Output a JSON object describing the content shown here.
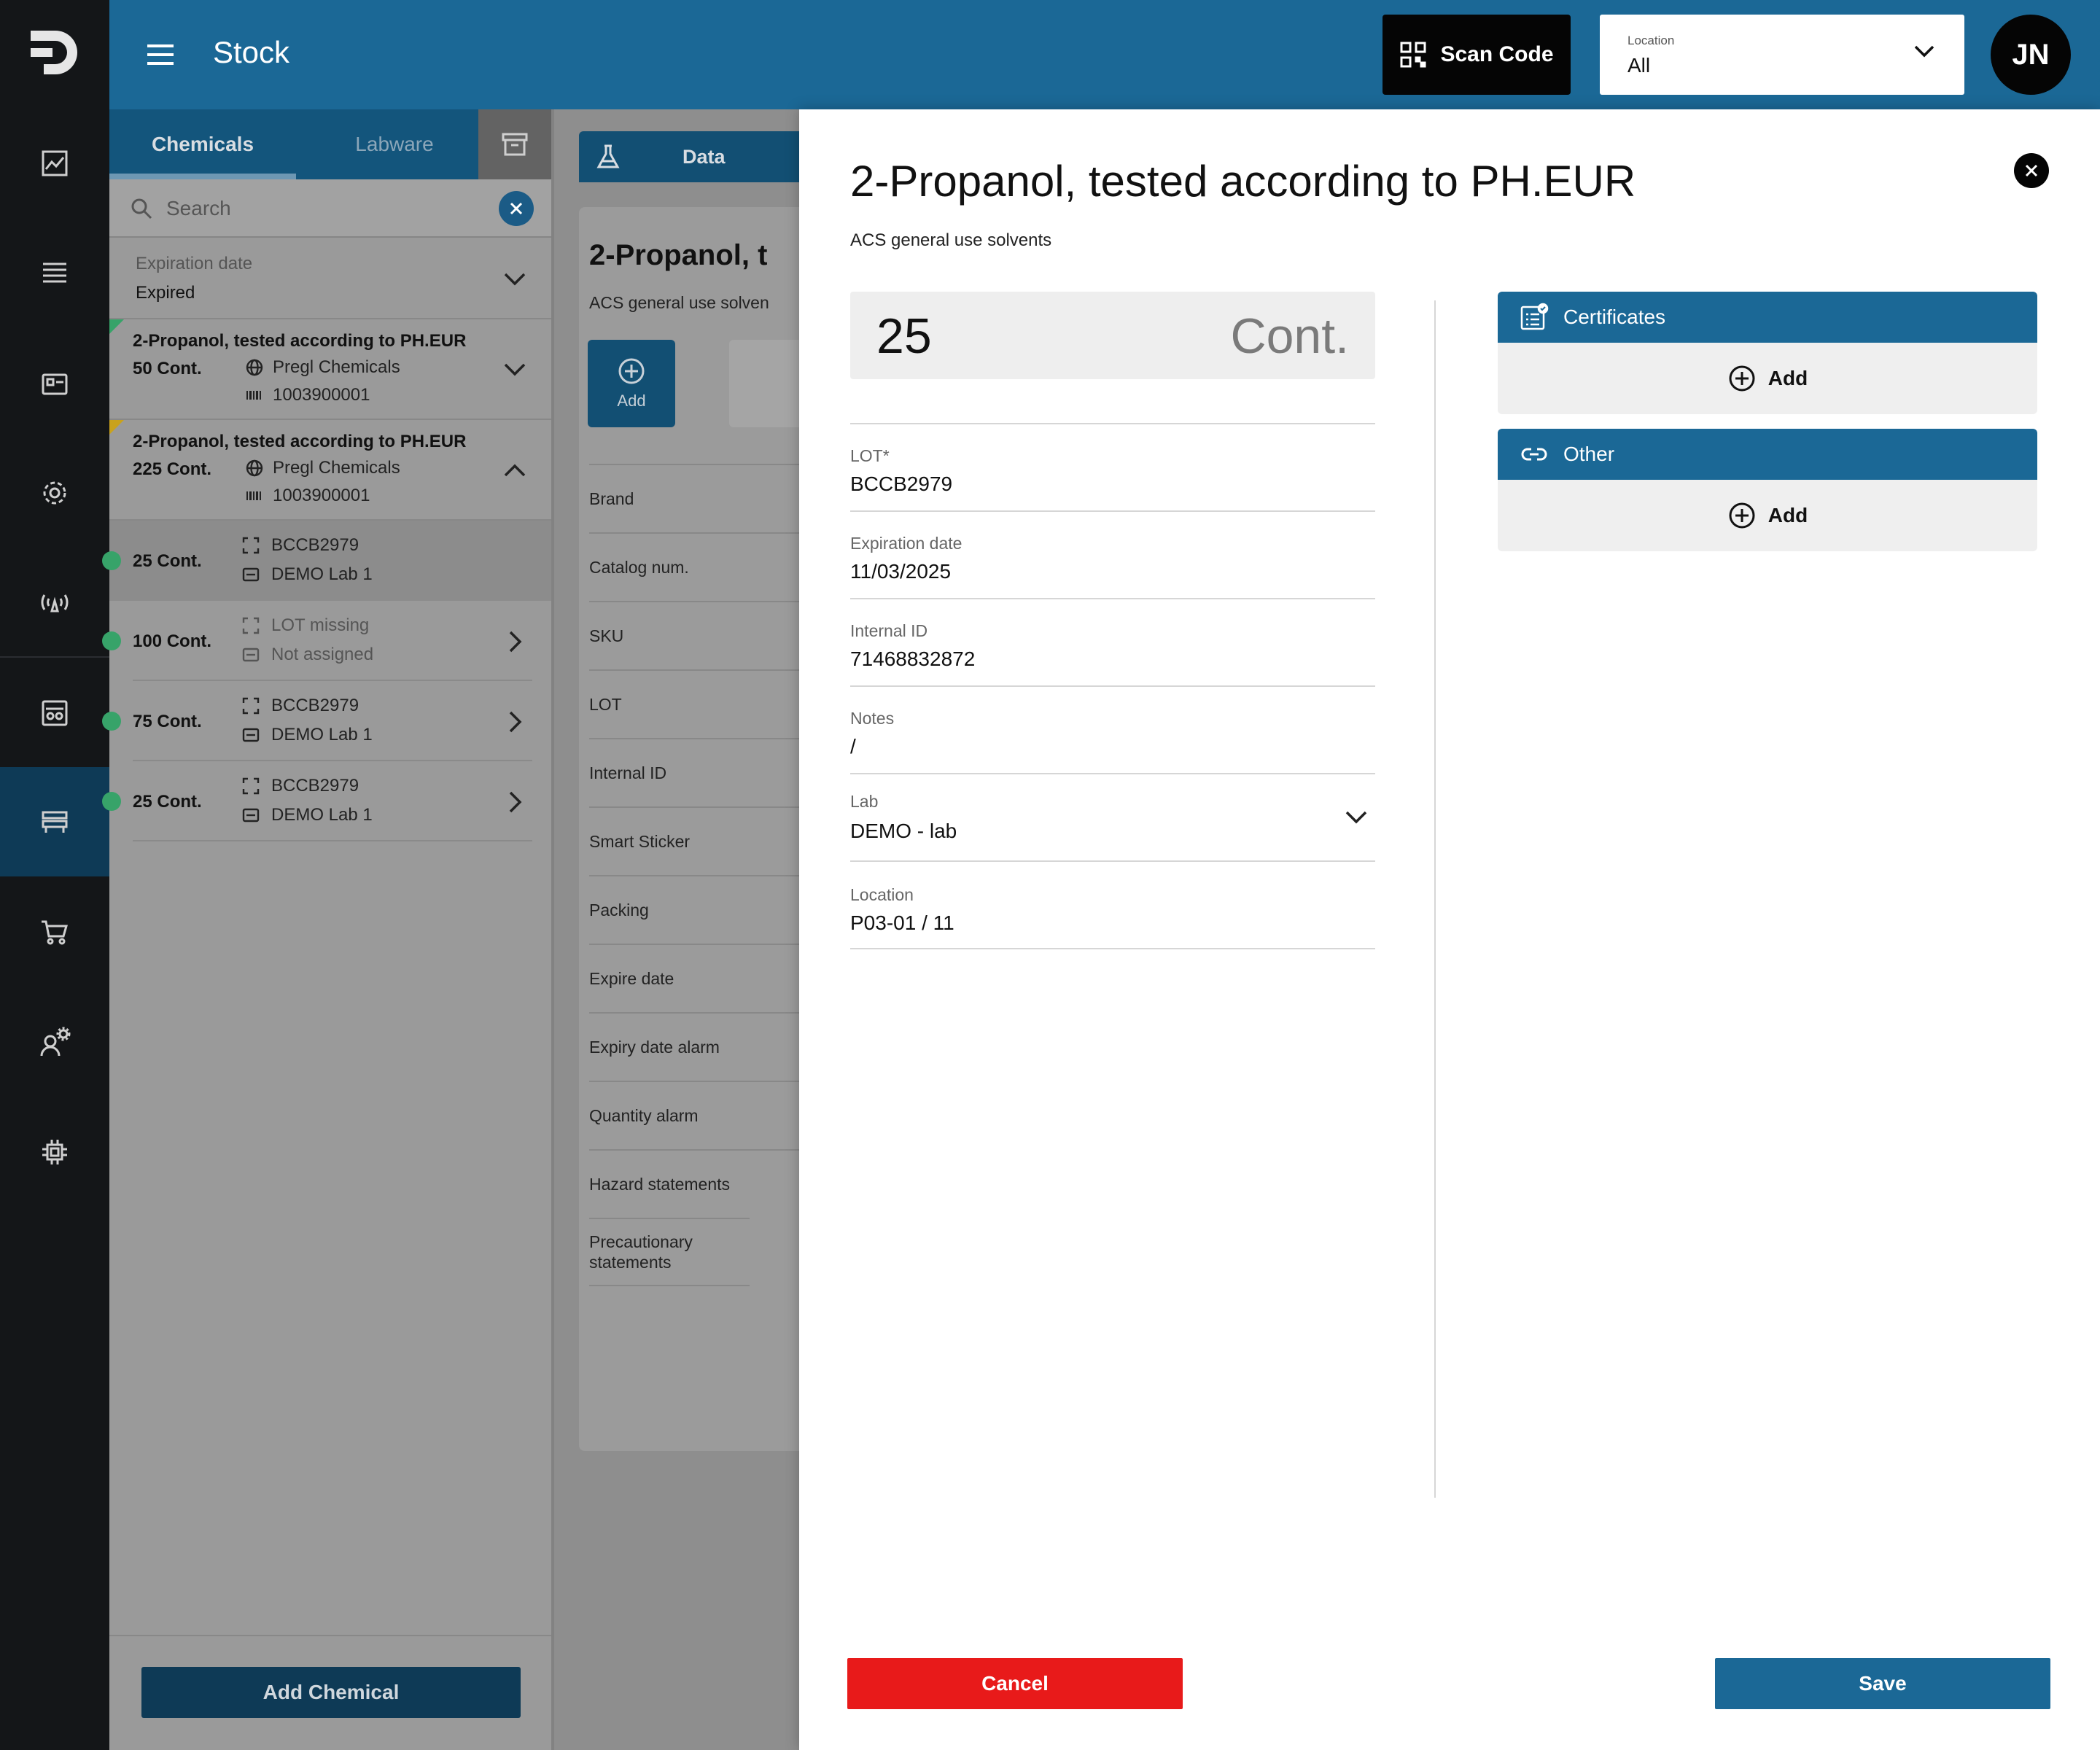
{
  "app": {
    "page_title": "Stock",
    "scan_label": "Scan Code",
    "location_label": "Location",
    "location_value": "All",
    "user_initials": "JN",
    "colors": {
      "primary": "#1b6896",
      "sidebar": "#141618",
      "cancel": "#e81a1a",
      "status_green": "#37a369"
    }
  },
  "sidebar": {
    "icons": [
      "logo-icon",
      "analytics-icon",
      "list-icon",
      "inventory-icon",
      "settings-gear-icon",
      "sensor-icon",
      "lab-instruments-icon",
      "stock-icon",
      "shopping-cart-icon",
      "user-settings-icon",
      "chip-icon"
    ],
    "active": "stock-icon"
  },
  "left_panel": {
    "tabs": [
      "Chemicals",
      "Labware"
    ],
    "active_tab": "Chemicals",
    "search_placeholder": "Search",
    "filter": {
      "label": "Expiration date",
      "value": "Expired"
    },
    "groups": [
      {
        "title": "2-Propanol, tested according to PH.EUR",
        "qty": "50 Cont.",
        "supplier": "Pregl Chemicals",
        "code": "1003900001",
        "expanded": false,
        "marker_color": "#37a369"
      },
      {
        "title": "2-Propanol, tested according to PH.EUR",
        "qty": "225 Cont.",
        "supplier": "Pregl Chemicals",
        "code": "1003900001",
        "expanded": true,
        "marker_color": "#c9a21c"
      }
    ],
    "items": [
      {
        "qty": "25 Cont.",
        "lot": "BCCB2979",
        "lab": "DEMO Lab 1",
        "selected": true
      },
      {
        "qty": "100 Cont.",
        "lot": "LOT missing",
        "lab": "Not assigned",
        "selected": false
      },
      {
        "qty": "75 Cont.",
        "lot": "BCCB2979",
        "lab": "DEMO Lab 1",
        "selected": false
      },
      {
        "qty": "25 Cont.",
        "lot": "BCCB2979",
        "lab": "DEMO Lab 1",
        "selected": false
      }
    ],
    "add_button": "Add Chemical"
  },
  "middle": {
    "tab": "Data",
    "title": "2-Propanol, t",
    "subtitle": "ACS general use solven",
    "add_label": "Add",
    "rows": [
      "Brand",
      "Catalog num.",
      "SKU",
      "LOT",
      "Internal ID",
      "Smart Sticker",
      "Packing",
      "Expire date",
      "Expiry date alarm",
      "Quantity alarm",
      "Hazard statements",
      "Precautionary statements"
    ]
  },
  "modal": {
    "title": "2-Propanol, tested according to PH.EUR",
    "subtitle": "ACS general use solvents",
    "quantity": "25",
    "unit": "Cont.",
    "fields": [
      {
        "label": "LOT*",
        "value": "BCCB2979"
      },
      {
        "label": "Expiration date",
        "value": "11/03/2025"
      },
      {
        "label": "Internal ID",
        "value": "71468832872"
      },
      {
        "label": "Notes",
        "value": "/"
      },
      {
        "label": "Lab",
        "value": "DEMO - lab"
      },
      {
        "label": "Location",
        "value": "P03-01 / 11"
      }
    ],
    "attachments": [
      {
        "title": "Certificates",
        "add": "Add"
      },
      {
        "title": "Other",
        "add": "Add"
      }
    ],
    "cancel": "Cancel",
    "save": "Save"
  }
}
